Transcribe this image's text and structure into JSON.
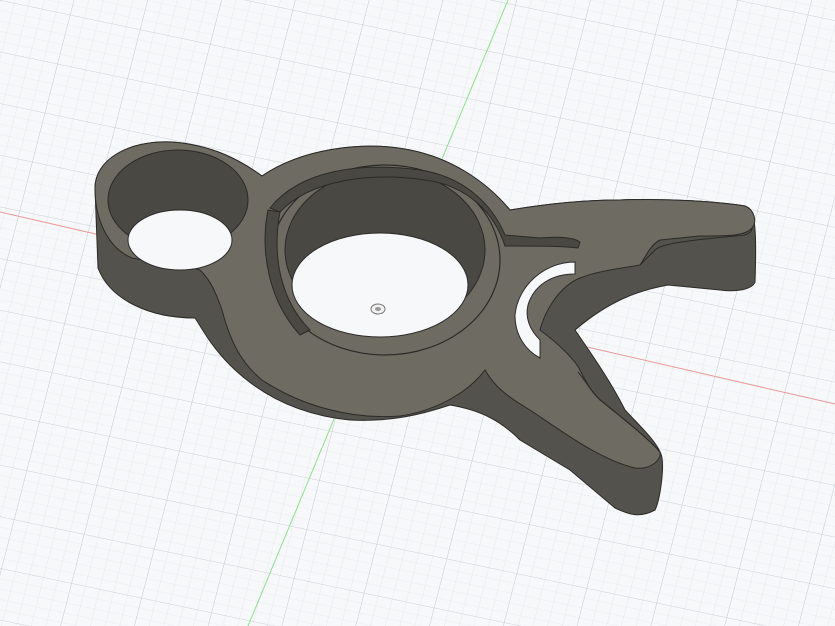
{
  "viewport": {
    "background_color": "#f7f8fa",
    "grid_minor_color": "#dde1e6",
    "grid_major_color": "#c4cad1",
    "x_axis_color": "#e79a9a",
    "y_axis_color": "#8ee08e",
    "origin_icon": "origin-marker-icon"
  },
  "model": {
    "body_color": "#6b6860",
    "top_face_color": "#6e6b63",
    "side_face_color": "#54524c",
    "inner_wall_color": "#4a4843",
    "edge_color": "#2b2a27"
  }
}
